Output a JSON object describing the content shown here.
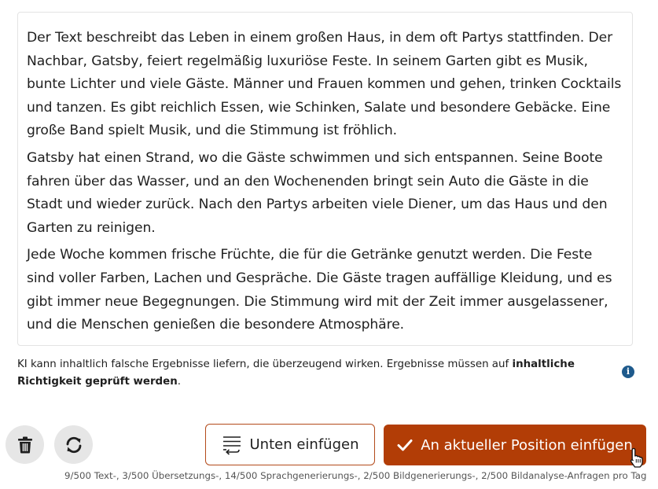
{
  "content": {
    "paragraphs": [
      "Der Text beschreibt das Leben in einem großen Haus, in dem oft Partys stattfinden. Der Nachbar, Gatsby, feiert regelmäßig luxuriöse Feste. In seinem Garten gibt es Musik, bunte Lichter und viele Gäste. Männer und Frauen kommen und gehen, trinken Cocktails und tanzen. Es gibt reichlich Essen, wie Schinken, Salate und besondere Gebäcke. Eine große Band spielt Musik, und die Stimmung ist fröhlich.",
      "Gatsby hat einen Strand, wo die Gäste schwimmen und sich entspannen. Seine Boote fahren über das Wasser, und an den Wochenenden bringt sein Auto die Gäste in die Stadt und wieder zurück. Nach den Partys arbeiten viele Diener, um das Haus und den Garten zu reinigen.",
      "Jede Woche kommen frische Früchte, die für die Getränke genutzt werden. Die Feste sind voller Farben, Lachen und Gespräche. Die Gäste tragen auffällige Kleidung, und es gibt immer neue Begegnungen. Die Stimmung wird mit der Zeit immer ausgelassener, und die Menschen genießen die besondere Atmosphäre."
    ]
  },
  "disclaimer": {
    "text": "KI kann inhaltlich falsche Ergebnisse liefern, die überzeugend wirken. Ergebnisse müssen auf ",
    "bold": "inhaltliche Richtigkeit geprüft werden",
    "end": "."
  },
  "icons": {
    "info": "info-icon",
    "delete": "trash-icon",
    "refresh": "refresh-icon",
    "insert_below": "insert-below-icon",
    "check": "check-icon",
    "cursor": "hand-pointer-icon"
  },
  "actions": {
    "insert_below_label": "Unten einfügen",
    "insert_here_label": "An aktueller Position einfügen"
  },
  "quota": "9/500 Text-, 3/500 Übersetzungs-, 14/500 Sprachgenerierungs-, 2/500 Bildgenerierungs-, 2/500 Bildanalyse-Anfragen pro Tag",
  "colors": {
    "accent": "#b23d06",
    "outline": "#b34a1a",
    "info": "#1e5a8c",
    "icon_button_bg": "#e6e6e6"
  }
}
